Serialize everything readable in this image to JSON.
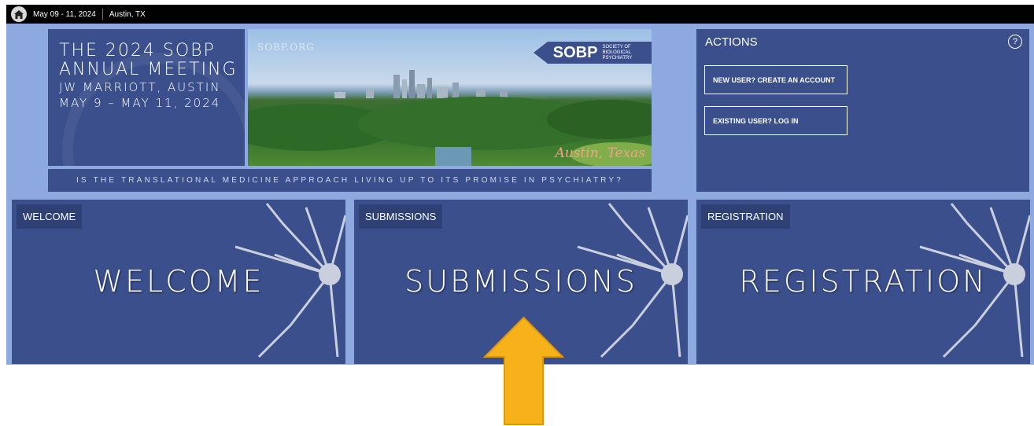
{
  "topbar": {
    "date": "May 09 - 11, 2024",
    "location": "Austin, TX"
  },
  "banner": {
    "title_line1": "THE 2024 SOBP",
    "title_line2": "ANNUAL MEETING",
    "venue": "JW MARRIOTT, AUSTIN",
    "dates": "MAY 9 – MAY 11, 2024",
    "site": "SOBP.ORG",
    "logo_text": "SOBP",
    "logo_sub1": "SOCIETY OF",
    "logo_sub2": "BIOLOGICAL",
    "logo_sub3": "PSYCHIATRY",
    "script_text": "Austin, Texas",
    "tagline": "IS THE TRANSLATIONAL MEDICINE APPROACH LIVING UP TO ITS PROMISE IN PSYCHIATRY?"
  },
  "actions": {
    "title": "ACTIONS",
    "help": "?",
    "create_account": "NEW USER? CREATE AN ACCOUNT",
    "login": "EXISTING USER? LOG IN"
  },
  "tiles": [
    {
      "label": "WELCOME",
      "big": "WELCOME"
    },
    {
      "label": "SUBMISSIONS",
      "big": "SUBMISSIONS"
    },
    {
      "label": "REGISTRATION",
      "big": "REGISTRATION"
    }
  ],
  "colors": {
    "panel": "#3b4f8c",
    "frame": "#8ea9e0",
    "arrow": "#f7b21b"
  },
  "icons": {
    "home": "home-icon",
    "help": "help-icon",
    "arrow": "up-arrow-icon"
  }
}
